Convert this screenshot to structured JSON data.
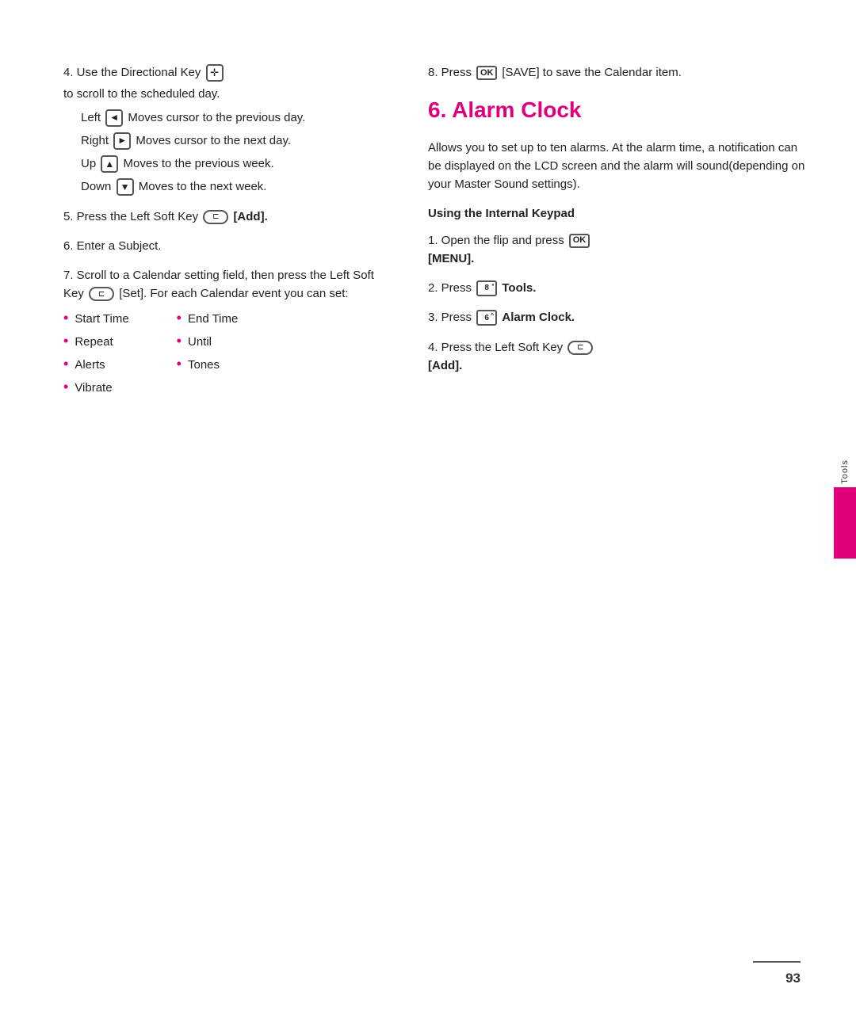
{
  "page": {
    "number": "93",
    "sidebar_label": "Tools"
  },
  "left_col": {
    "item4_heading": "4. Use the Directional Key",
    "item4_sub": "to scroll to the scheduled day.",
    "left_label": "Left",
    "left_desc": "Moves cursor to the previous day.",
    "right_label": "Right",
    "right_desc": "Moves cursor to the next day.",
    "up_label": "Up",
    "up_desc": "Moves to the previous week.",
    "down_label": "Down",
    "down_desc": "Moves to the next week.",
    "item5": "5. Press the Left Soft Key",
    "item5_add": "[Add].",
    "item6": "6. Enter a Subject.",
    "item7": "7. Scroll to a Calendar setting field, then press the Left Soft Key",
    "item7_set": "[Set]. For each Calendar event you can set:",
    "bullets_left": [
      "Start Time",
      "Repeat",
      "Alerts",
      "Vibrate"
    ],
    "bullets_right": [
      "End Time",
      "Until",
      "Tones"
    ]
  },
  "right_col": {
    "item8": "8. Press",
    "item8_key": "OK",
    "item8_rest": "[SAVE] to save the Calendar item.",
    "section_title": "6. Alarm Clock",
    "section_desc": "Allows you to set up to ten alarms. At the alarm time, a notification can be displayed on the LCD screen and the alarm will sound(depending on your Master Sound settings).",
    "subheading": "Using the Internal Keypad",
    "step1": "1. Open the flip and press",
    "step1_key": "OK",
    "step1_rest": "[MENU].",
    "step2": "2. Press",
    "step2_key": "8*",
    "step2_rest": "Tools.",
    "step3": "3. Press",
    "step3_key": "6^",
    "step3_rest": "Alarm Clock.",
    "step4": "4. Press the Left Soft Key",
    "step4_add": "[Add]."
  },
  "icons": {
    "ok_label": "OK",
    "softkey_label": "",
    "dir_left": "◄",
    "dir_right": "►",
    "dir_up": "▲",
    "dir_down": "▼",
    "dir_center": "✛"
  }
}
